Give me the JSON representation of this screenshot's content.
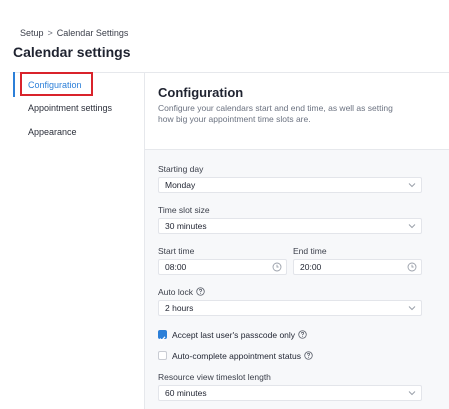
{
  "breadcrumb": {
    "root": "Setup",
    "separator": ">",
    "current": "Calendar Settings"
  },
  "page": {
    "title": "Calendar settings"
  },
  "sidebar": {
    "items": [
      {
        "label": "Configuration",
        "active": true
      },
      {
        "label": "Appointment settings",
        "active": false
      },
      {
        "label": "Appearance",
        "active": false
      }
    ]
  },
  "main": {
    "title": "Configuration",
    "description": "Configure your calendars start and end time, as well as setting how big your appointment time slots are."
  },
  "form": {
    "starting_day": {
      "label": "Starting day",
      "value": "Monday"
    },
    "time_slot_size": {
      "label": "Time slot size",
      "value": "30 minutes"
    },
    "start_time": {
      "label": "Start time",
      "value": "08:00"
    },
    "end_time": {
      "label": "End time",
      "value": "20:00"
    },
    "auto_lock": {
      "label": "Auto lock",
      "value": "2 hours"
    },
    "accept_last_passcode": {
      "label": "Accept last user's passcode only",
      "checked": true
    },
    "auto_complete": {
      "label": "Auto-complete appointment status",
      "checked": false
    },
    "resource_view": {
      "label": "Resource view timeslot length",
      "value": "60 minutes"
    }
  },
  "colors": {
    "accent": "#2c7fd8",
    "highlight": "#d9232b",
    "panel_bg": "#f7f8fa"
  },
  "icons": {
    "select": "chevron-down-icon",
    "time": "clock-icon",
    "help": "help-circle-icon",
    "check": "checkmark-icon"
  }
}
